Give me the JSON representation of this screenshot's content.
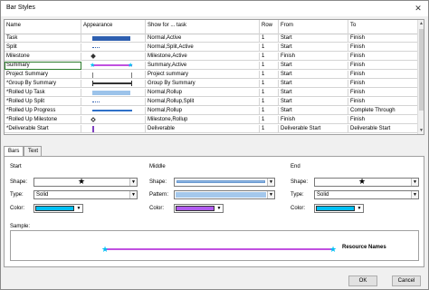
{
  "window": {
    "title": "Bar Styles",
    "close_glyph": "✕"
  },
  "columns": {
    "name": "Name",
    "appearance": "Appearance",
    "show_for": "Show for ... task",
    "row": "Row",
    "from": "From",
    "to": "To"
  },
  "rows": [
    {
      "name": "Task",
      "show_for": "Normal,Active",
      "row": "1",
      "from": "Start",
      "to": "Finish",
      "appearance": "bar-blue"
    },
    {
      "name": "Split",
      "show_for": "Normal,Split,Active",
      "row": "1",
      "from": "Start",
      "to": "Finish",
      "appearance": "dotted"
    },
    {
      "name": "Milestone",
      "show_for": "Milestone,Active",
      "row": "1",
      "from": "Finish",
      "to": "Finish",
      "appearance": "diamond"
    },
    {
      "name": "Summary",
      "show_for": "Summary,Active",
      "row": "1",
      "from": "Start",
      "to": "Finish",
      "appearance": "summary-star"
    },
    {
      "name": "Project Summary",
      "show_for": "Project summary",
      "row": "1",
      "from": "Start",
      "to": "Finish",
      "appearance": "project-summary"
    },
    {
      "name": "*Group By Summary",
      "show_for": "Group By Summary",
      "row": "1",
      "from": "Start",
      "to": "Finish",
      "appearance": "group-summary"
    },
    {
      "name": "*Rolled Up Task",
      "show_for": "Normal,Rollup",
      "row": "1",
      "from": "Start",
      "to": "Finish",
      "appearance": "bar-light-blue"
    },
    {
      "name": "*Rolled Up Split",
      "show_for": "Normal,Rollup,Split",
      "row": "1",
      "from": "Start",
      "to": "Finish",
      "appearance": "dotted"
    },
    {
      "name": "*Rolled Up Progress",
      "show_for": "Normal,Rollup",
      "row": "1",
      "from": "Start",
      "to": "Complete Through",
      "appearance": "thin-blue"
    },
    {
      "name": "*Rolled Up Milestone",
      "show_for": "Milestone,Rollup",
      "row": "1",
      "from": "Finish",
      "to": "Finish",
      "appearance": "diamond-outline"
    },
    {
      "name": "*Deliverable Start",
      "show_for": "Deliverable",
      "row": "1",
      "from": "Deliverable Start",
      "to": "Deliverable Start",
      "appearance": "purple-tick"
    }
  ],
  "tabs": {
    "bars": "Bars",
    "text": "Text"
  },
  "start": {
    "heading": "Start",
    "shape_label": "Shape:",
    "type_label": "Type:",
    "type_value": "Solid",
    "color_label": "Color:",
    "color": "#00bff3",
    "shape_icon": "star-icon"
  },
  "middle": {
    "heading": "Middle",
    "shape_label": "Shape:",
    "pattern_label": "Pattern:",
    "color_label": "Color:",
    "color": "#b15cf0",
    "pattern_color": "#a4c8ec"
  },
  "end": {
    "heading": "End",
    "shape_label": "Shape:",
    "type_label": "Type:",
    "type_value": "Solid",
    "color_label": "Color:",
    "color": "#00bff3",
    "shape_icon": "star-icon"
  },
  "sample": {
    "label": "Sample:",
    "text": "Resource Names",
    "bar_color": "#c050e0",
    "star_color": "#00bff3"
  },
  "buttons": {
    "ok": "OK",
    "cancel": "Cancel"
  }
}
